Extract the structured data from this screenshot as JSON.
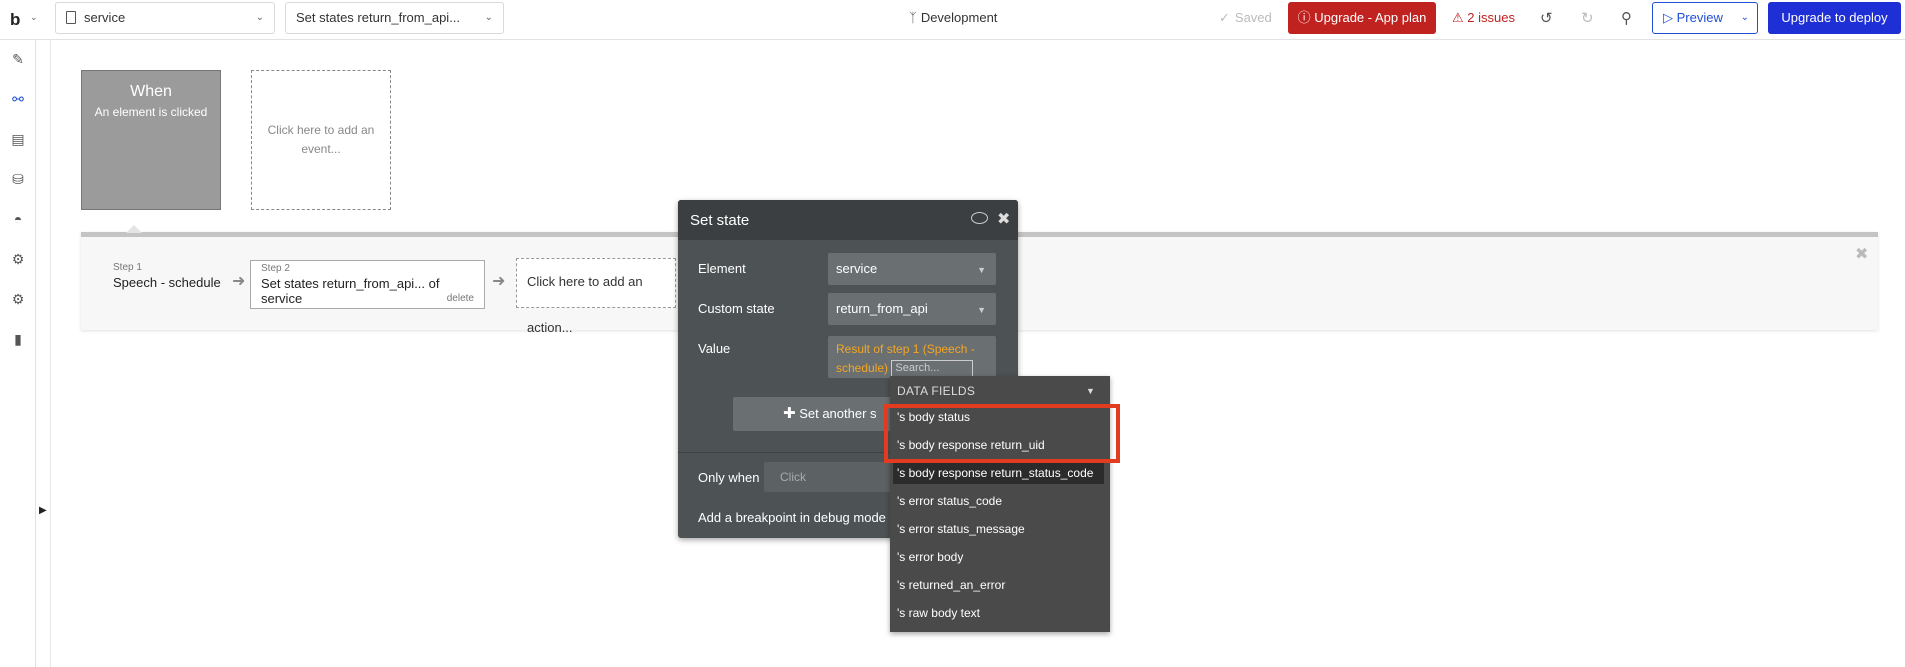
{
  "topbar": {
    "logo": "b",
    "page_selector": "service",
    "workflow_selector": "Set states return_from_api...",
    "branch": "Development",
    "saved": "Saved",
    "upgrade_plan": "Upgrade - App plan",
    "issues": "2 issues",
    "preview": "Preview",
    "deploy": "Upgrade to deploy"
  },
  "sidebar": {
    "icons": [
      "pencil-icon",
      "workflow-icon",
      "data-icon",
      "database-icon",
      "palette-icon",
      "plugin-icon",
      "settings-icon",
      "logs-icon"
    ],
    "active": "workflow-icon"
  },
  "event": {
    "title": "When",
    "subtitle": "An element is clicked",
    "add_event": "Click here to add an event..."
  },
  "workflow": {
    "step1": {
      "label": "Step 1",
      "text": "Speech - schedule"
    },
    "step2": {
      "label": "Step 2",
      "text": "Set states return_from_api... of service",
      "delete": "delete"
    },
    "add_action": "Click here to add an action..."
  },
  "panel": {
    "title": "Set state",
    "element_label": "Element",
    "element_value": "service",
    "custom_state_label": "Custom state",
    "custom_state_value": "return_from_api",
    "value_label": "Value",
    "value_expr_1": "Result of step 1 (Speech -",
    "value_expr_2": "schedule)",
    "search_placeholder": "Search...",
    "set_another": "Set another s",
    "only_when_label": "Only when",
    "only_when_placeholder": "Click",
    "breakpoint_label": "Add a breakpoint in debug mode"
  },
  "dropdown": {
    "header": "DATA FIELDS",
    "items": [
      "'s body status",
      "'s body response return_uid",
      "'s body response return_status_code",
      "'s error status_code",
      "'s error status_message",
      "'s error body",
      "'s returned_an_error",
      "'s raw body text"
    ],
    "highlighted_index": 2
  },
  "colors": {
    "accent": "#1f4fd6",
    "danger": "#c0221f",
    "expression": "#f5a623",
    "annotation": "#e33b1f"
  }
}
